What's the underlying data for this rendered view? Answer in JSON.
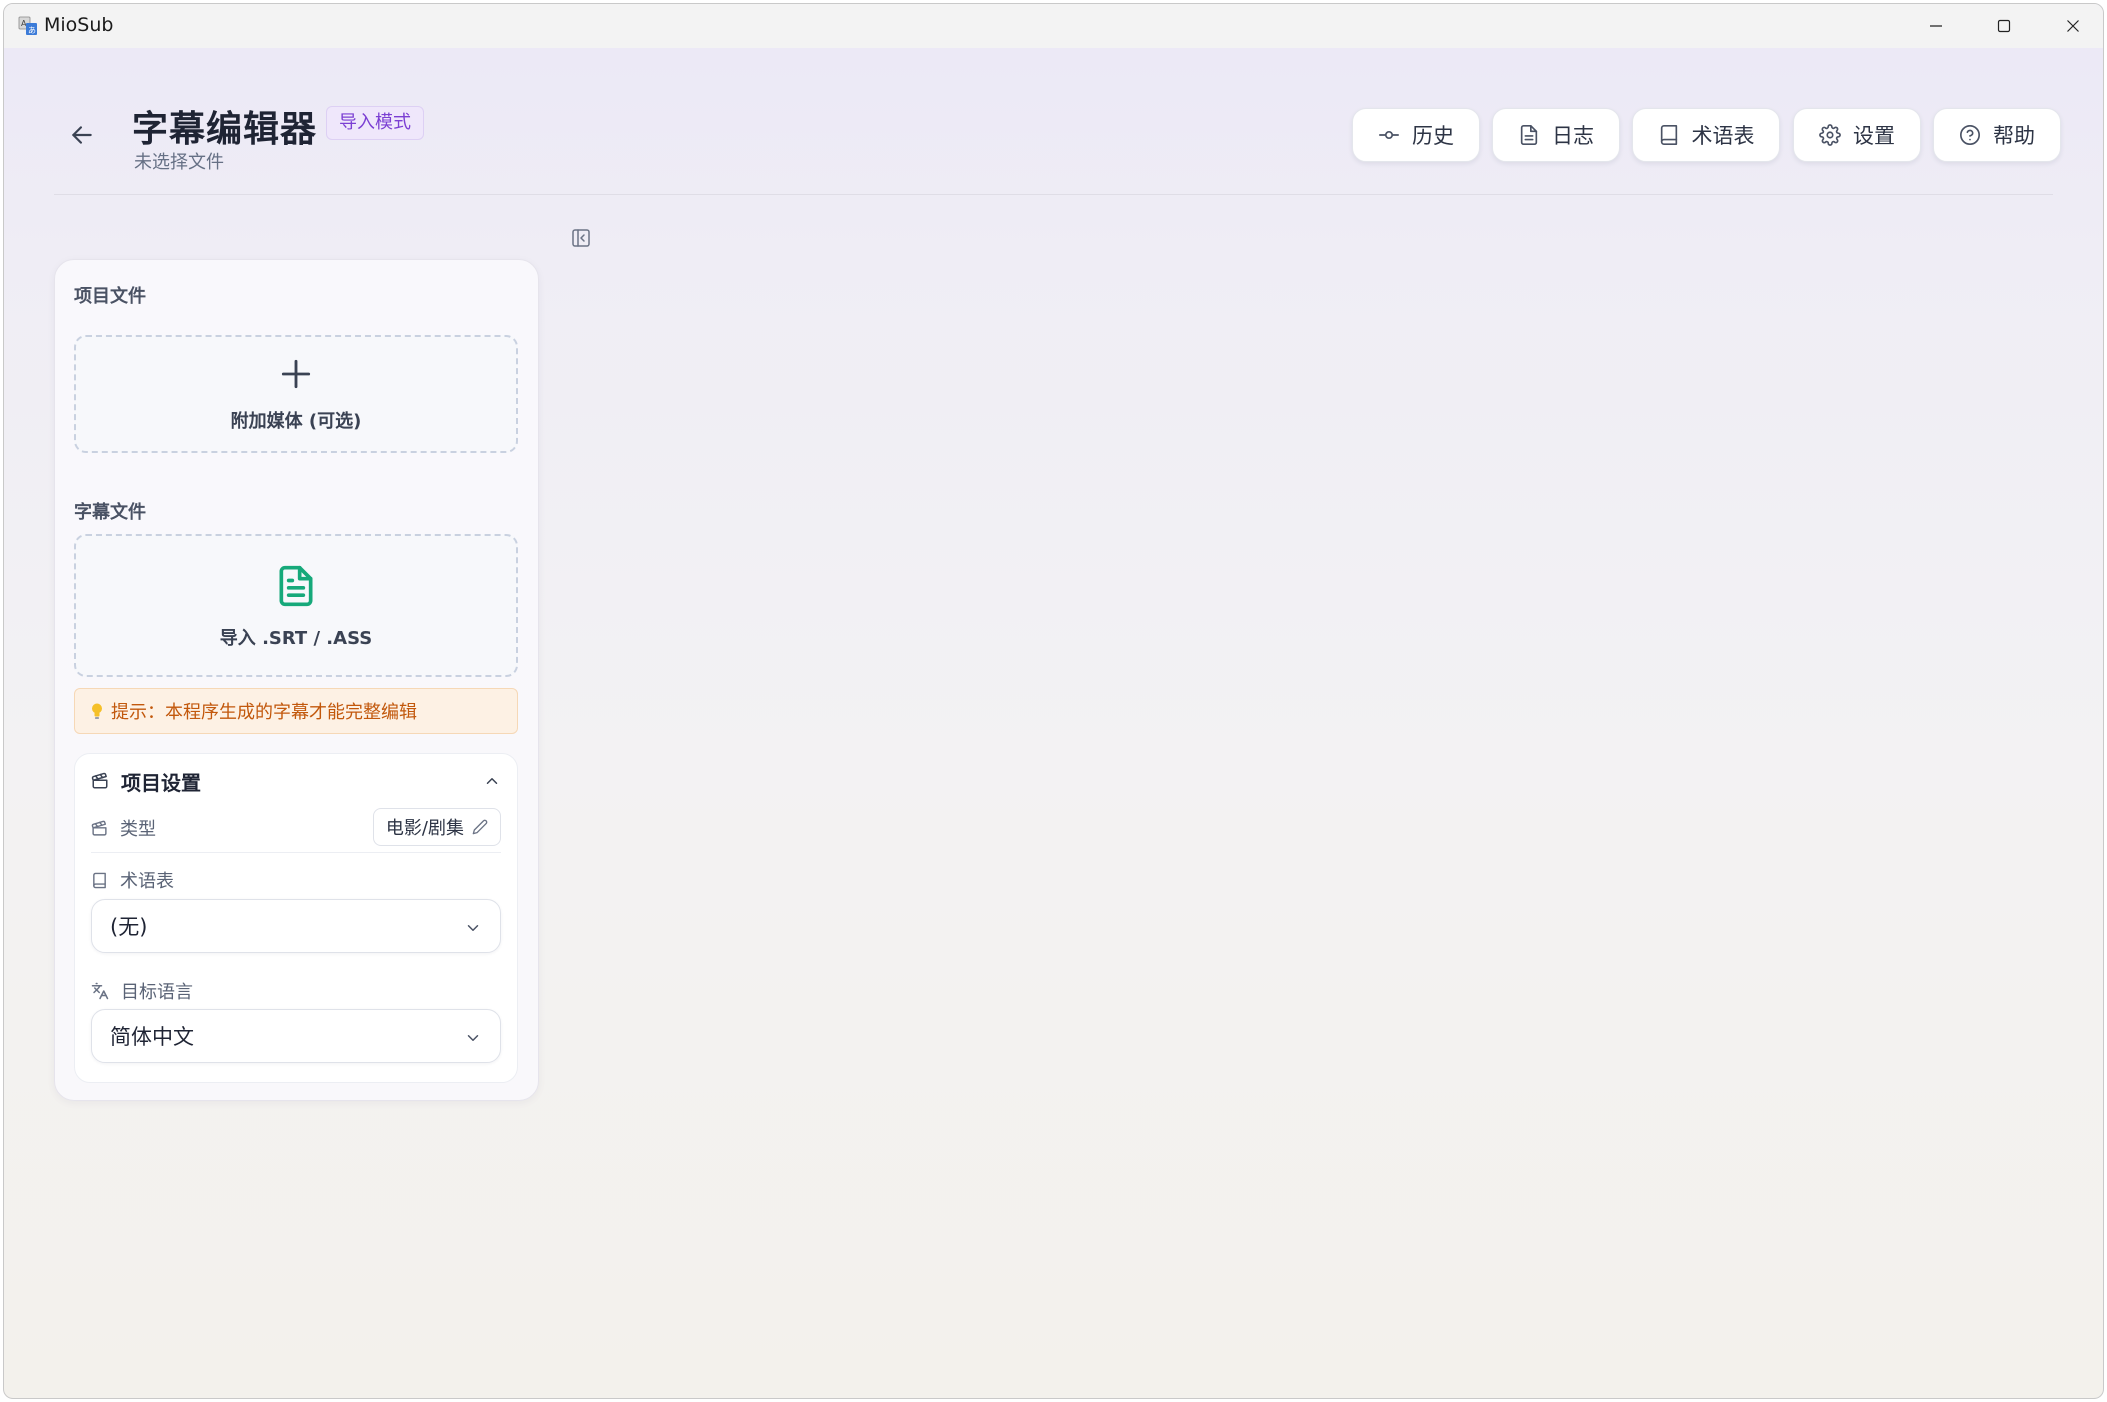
{
  "window": {
    "app_title": "MioSub"
  },
  "header": {
    "title": "字幕编辑器",
    "mode_badge": "导入模式",
    "subtitle": "未选择文件",
    "buttons": {
      "history": "历史",
      "log": "日志",
      "glossary": "术语表",
      "settings": "设置",
      "help": "帮助"
    }
  },
  "sidebar": {
    "project_files_label": "项目文件",
    "attach_media_label": "附加媒体 (可选)",
    "subtitle_files_label": "字幕文件",
    "import_subtitle_label": "导入 .SRT / .ASS",
    "tip_text": "提示：本程序生成的字幕才能完整编辑",
    "project_settings": {
      "title": "项目设置",
      "type_label": "类型",
      "type_value": "电影/剧集",
      "glossary_label": "术语表",
      "glossary_value": "(无)",
      "target_language_label": "目标语言",
      "target_language_value": "简体中文"
    }
  },
  "colors": {
    "accent_purple": "#7b3fd3",
    "file_icon_green": "#16a97a",
    "tip_orange": "#c2580c"
  },
  "icons": {
    "back": "arrow-left-icon",
    "history": "commit-icon",
    "log": "file-text-icon",
    "glossary": "book-icon",
    "settings": "gear-icon",
    "help": "help-circle-icon",
    "collapse": "sidebar-collapse-icon",
    "add": "plus-icon",
    "subtitle_file": "file-text-icon",
    "tip": "lightbulb-icon",
    "clapperboard": "clapperboard-icon",
    "translate": "translate-icon"
  }
}
